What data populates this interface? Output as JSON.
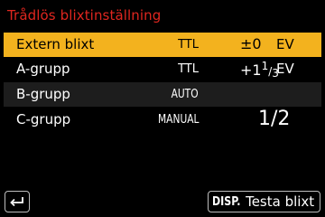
{
  "title": "Trådlös blixtinställning",
  "rows": [
    {
      "name": "Extern blixt",
      "mode": "TTL",
      "value": "±0",
      "unit": "EV",
      "selected": true
    },
    {
      "name": "A-grupp",
      "mode": "TTL",
      "value_prefix": "+1",
      "value_num": "1",
      "value_den": "3",
      "unit": "EV"
    },
    {
      "name": "B-grupp",
      "mode": "AUTO"
    },
    {
      "name": "C-grupp",
      "mode": "MANUAL",
      "value": "1/2"
    }
  ],
  "footer": {
    "back_icon": "return-arrow-icon",
    "disp_label": "DISP.",
    "action_label": "Testa blixt"
  },
  "colors": {
    "title": "#e0261f",
    "selected_row": "#f3b21e",
    "alt_row": "#1d1d1d"
  }
}
